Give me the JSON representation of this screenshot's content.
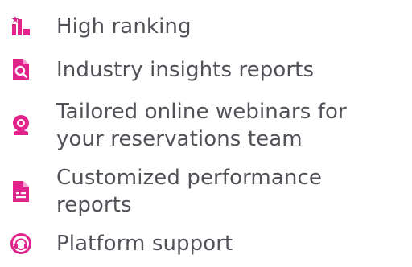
{
  "accent_color": "#e0248c",
  "text_color": "#515158",
  "features": [
    {
      "icon": "bar-chart-star-icon",
      "label": "High ranking"
    },
    {
      "icon": "document-search-icon",
      "label": "Industry insights reports"
    },
    {
      "icon": "webcam-icon",
      "label_lines": [
        "Tailored online webinars for",
        "your reservations team"
      ]
    },
    {
      "icon": "report-document-icon",
      "label_lines": [
        "Customized performance",
        "reports"
      ]
    },
    {
      "icon": "headset-support-icon",
      "label": "Platform support"
    }
  ]
}
